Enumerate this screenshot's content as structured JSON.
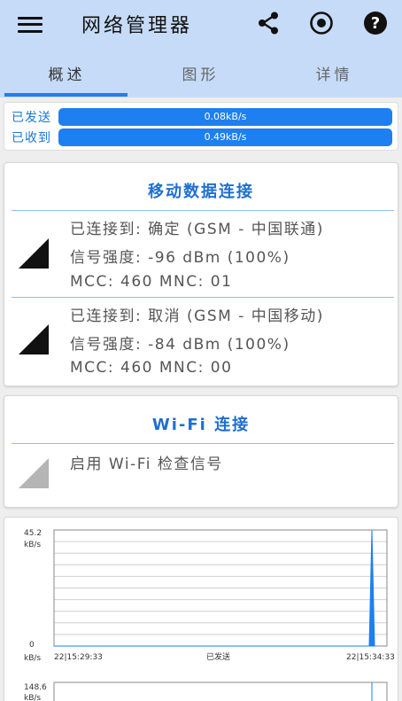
{
  "app": {
    "title": "网络管理器",
    "icons": {
      "menu": "hamburger-menu-icon",
      "share": "share-icon",
      "record": "record-icon",
      "help": "help-icon"
    }
  },
  "tabs": [
    {
      "label": "概述",
      "active": true
    },
    {
      "label": "图形",
      "active": false
    },
    {
      "label": "详情",
      "active": false
    }
  ],
  "traffic": {
    "sent_label": "已发送",
    "sent_value": "0.08kB/s",
    "received_label": "已收到",
    "received_value": "0.49kB/s"
  },
  "mobile_data": {
    "title": "移动数据连接",
    "sims": [
      {
        "connected": "已连接到: 确定 (GSM - 中国联通)",
        "signal": "信号强度: -96 dBm (100%)",
        "mcc_mnc": "MCC: 460 MNC: 01",
        "signal_level": 1.0
      },
      {
        "connected": "已连接到: 取消 (GSM - 中国移动)",
        "signal": "信号强度: -84 dBm (100%)",
        "mcc_mnc": "MCC: 460 MNC: 00",
        "signal_level": 1.0
      }
    ]
  },
  "wifi": {
    "title": "Wi-Fi 连接",
    "message": "启用 Wi-Fi 检查信号"
  },
  "sent_chart": {
    "y_max": "45.2",
    "y_max_unit": "kB/s",
    "y_min": "0",
    "y_min_unit": "kB/s",
    "x_start": "22|15:29:33",
    "x_end": "22|15:34:33",
    "caption": "已发送"
  },
  "received_chart": {
    "y_max": "148.6",
    "y_max_unit": "kB/s"
  },
  "chart_data": [
    {
      "type": "area",
      "title": "已发送",
      "x": [
        "22|15:29:33",
        "22|15:34:33"
      ],
      "ylim": [
        0,
        45.2
      ],
      "yunit": "kB/s",
      "series": [
        {
          "values": [
            0,
            0,
            45.2,
            0
          ]
        }
      ],
      "color": "#1e7ff0"
    },
    {
      "type": "area",
      "ylim": [
        0,
        148.6
      ],
      "yunit": "kB/s"
    }
  ],
  "colors": {
    "accent": "#1e7ff0",
    "header_bg": "#c6dbf7",
    "title_blue": "#1f6fcf"
  }
}
